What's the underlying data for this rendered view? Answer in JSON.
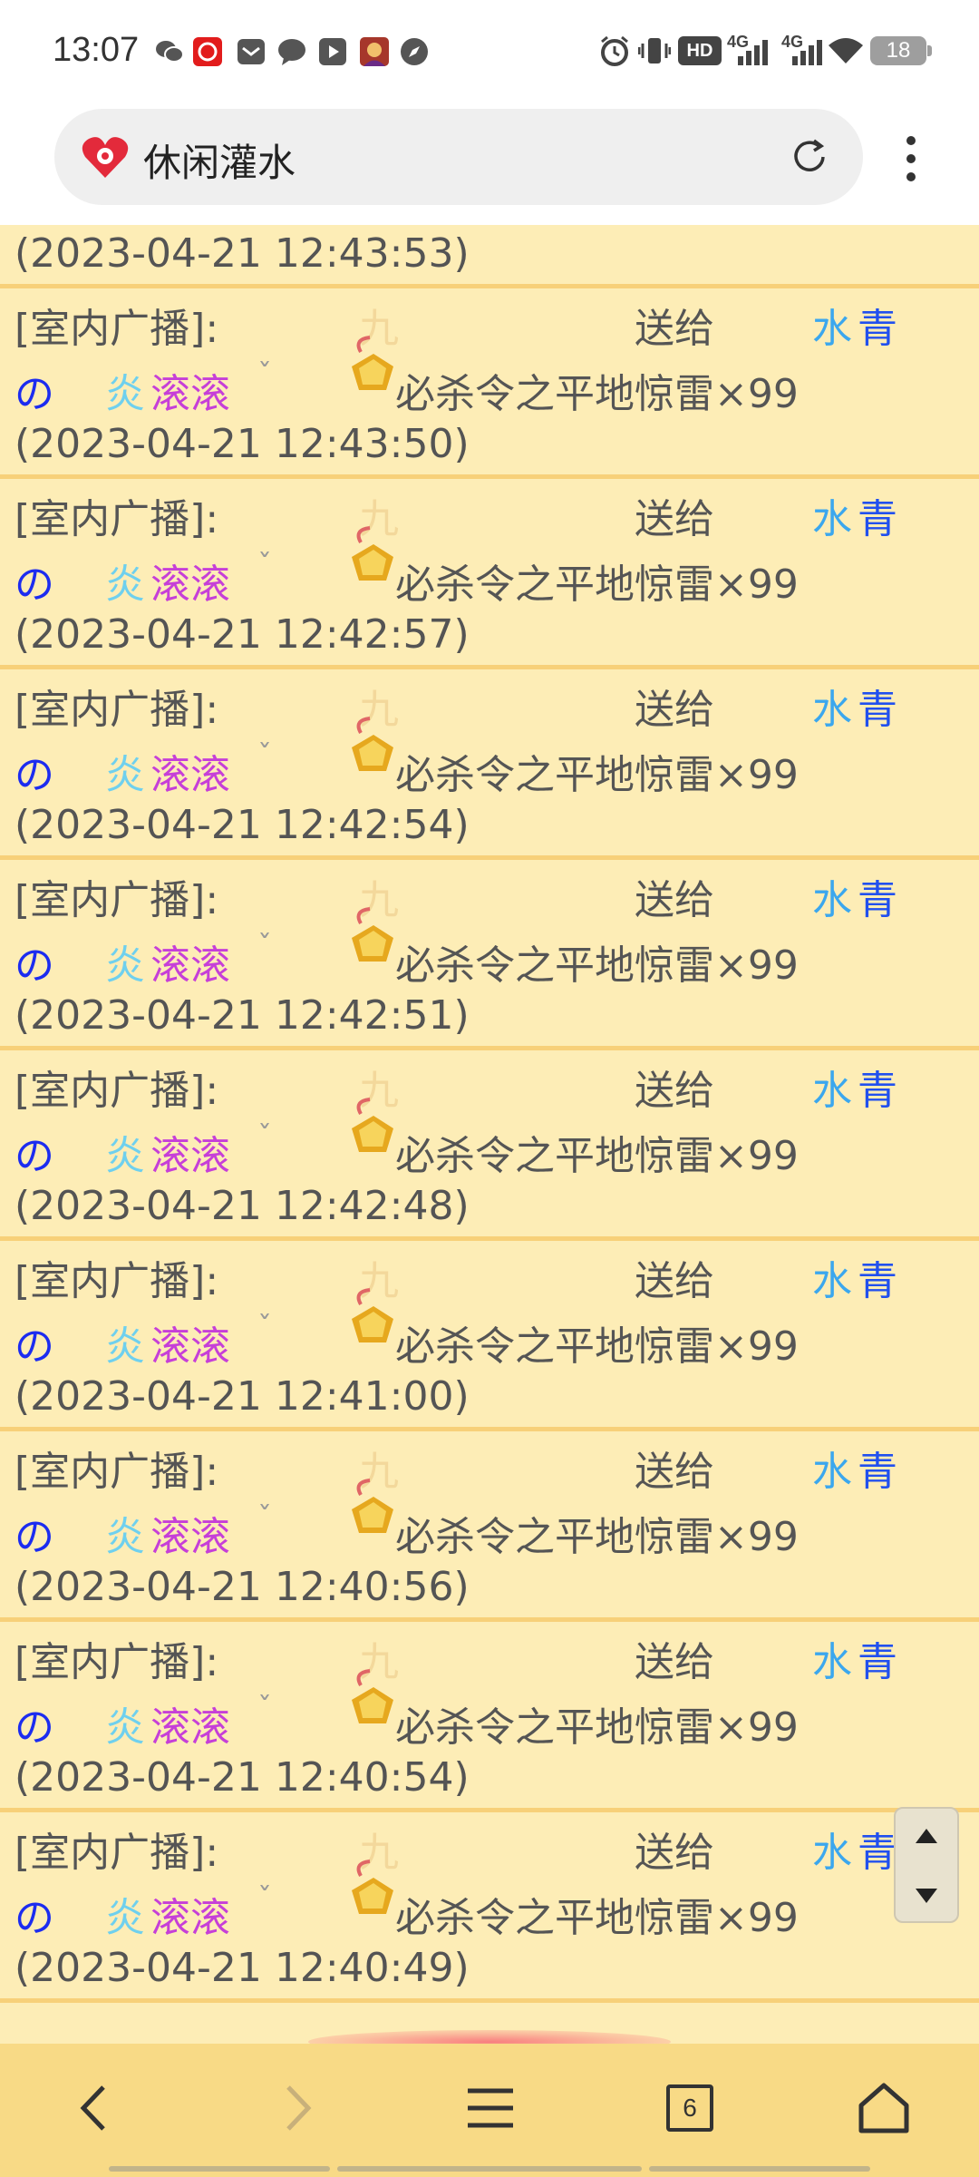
{
  "status_bar": {
    "time": "13:07",
    "battery": "18",
    "network_1": "4G",
    "network_2": "4G",
    "hd": "HD"
  },
  "browser": {
    "page_title": "休闲灌水"
  },
  "entry_template": {
    "label": "[室内广播]:",
    "sender": "九",
    "action": "送给",
    "receiver_1": "水",
    "receiver_2": "青",
    "receiver_3": "の",
    "receiver_4": "炎",
    "receiver_5": "滚滚",
    "mark": "ˇ",
    "gift_name": "必杀令之平地惊雷×99"
  },
  "partial_entry": {
    "timestamp": "(2023-04-21 12:43:53)"
  },
  "entries": [
    {
      "timestamp": "(2023-04-21 12:43:50)"
    },
    {
      "timestamp": "(2023-04-21 12:42:57)"
    },
    {
      "timestamp": "(2023-04-21 12:42:54)"
    },
    {
      "timestamp": "(2023-04-21 12:42:51)"
    },
    {
      "timestamp": "(2023-04-21 12:42:48)"
    },
    {
      "timestamp": "(2023-04-21 12:41:00)"
    },
    {
      "timestamp": "(2023-04-21 12:40:56)"
    },
    {
      "timestamp": "(2023-04-21 12:40:54)"
    },
    {
      "timestamp": "(2023-04-21 12:40:49)"
    }
  ],
  "navbar": {
    "tab_count": "6"
  },
  "colors": {
    "page_bg": "#fdedb6",
    "divider": "#f7d079",
    "navbar_bg": "#f8da86"
  }
}
